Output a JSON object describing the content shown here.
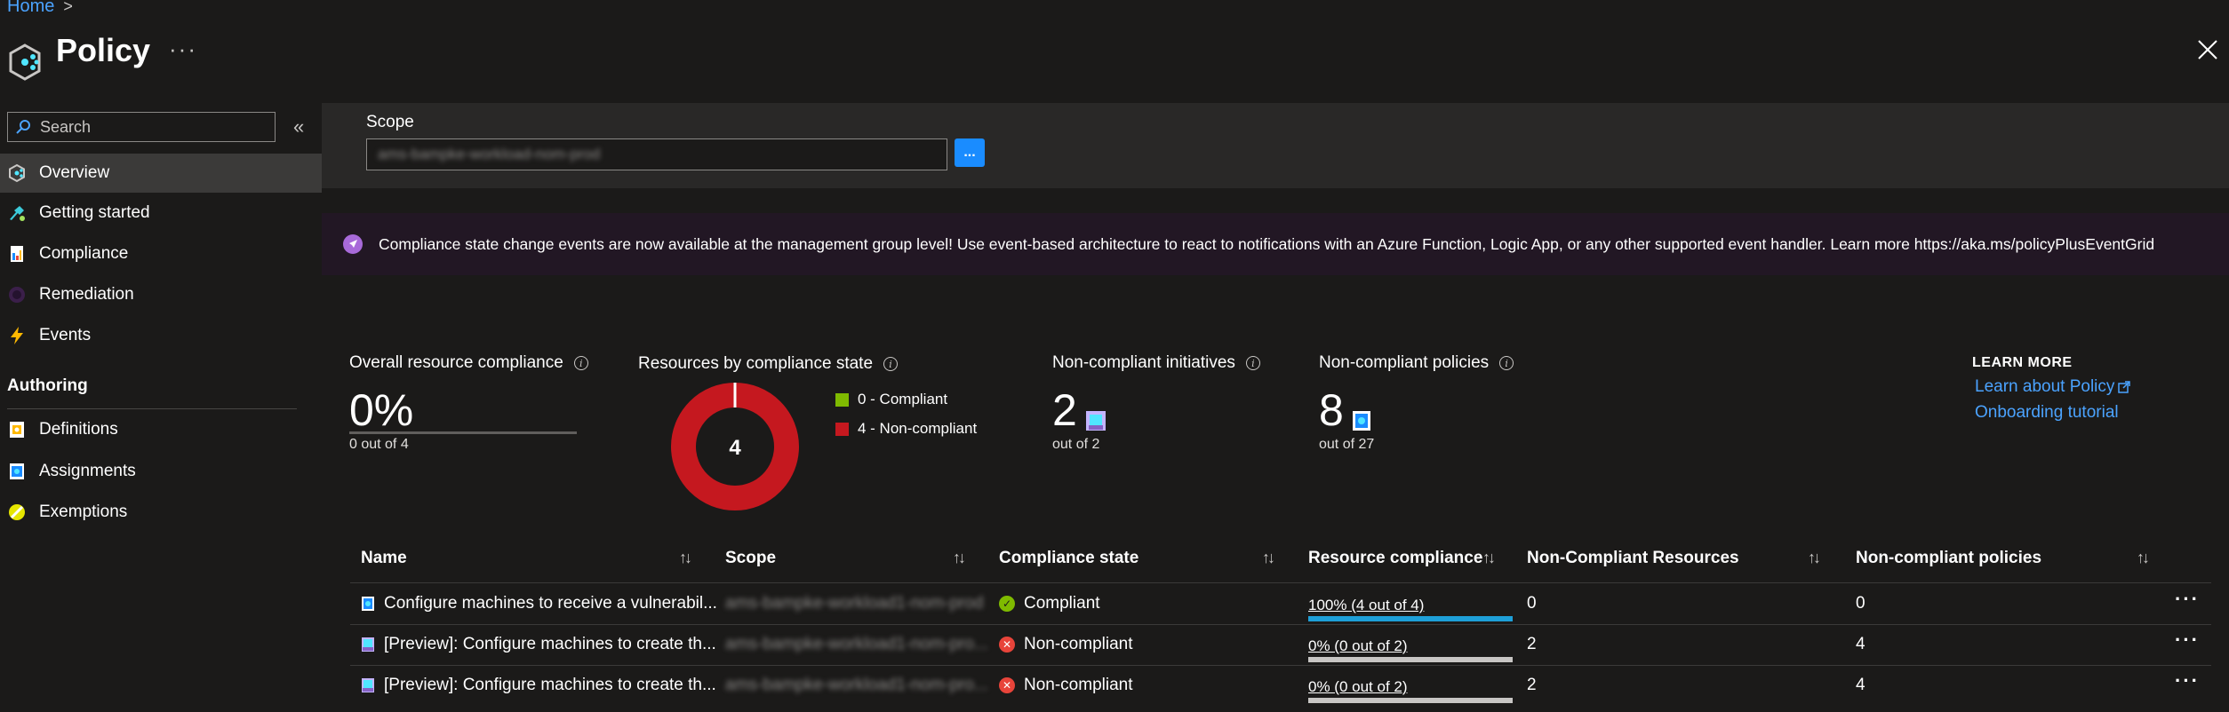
{
  "breadcrumb": {
    "home": "Home",
    "separator": ">"
  },
  "header": {
    "title": "Policy",
    "more": "···",
    "close_icon": "close-icon"
  },
  "search": {
    "placeholder": "Search"
  },
  "sidebar": {
    "collapse": "«",
    "items": [
      {
        "label": "Overview",
        "icon": "overview-icon",
        "active": true
      },
      {
        "label": "Getting started",
        "icon": "getting-started-icon"
      },
      {
        "label": "Compliance",
        "icon": "compliance-icon"
      },
      {
        "label": "Remediation",
        "icon": "remediation-icon"
      },
      {
        "label": "Events",
        "icon": "lightning-icon"
      }
    ],
    "authoring_title": "Authoring",
    "authoring_items": [
      {
        "label": "Definitions",
        "icon": "definitions-icon"
      },
      {
        "label": "Assignments",
        "icon": "assignments-icon"
      },
      {
        "label": "Exemptions",
        "icon": "exemptions-icon"
      }
    ]
  },
  "scope": {
    "label": "Scope",
    "value": "ams-bampke-workload-nom-prod",
    "button": "..."
  },
  "banner": {
    "text": "Compliance state change events are now available at the management group level! Use event-based architecture to react to notifications with an Azure Function, Logic App, or any other supported event handler. Learn more https://aka.ms/policyPlusEventGrid"
  },
  "stats": {
    "overall": {
      "title": "Overall resource compliance",
      "value": "0%",
      "sub": "0 out of 4",
      "fraction": 0
    },
    "by_state": {
      "title": "Resources by compliance state",
      "center": "4",
      "legend": [
        {
          "label": "0 - Compliant",
          "count": 0,
          "color": "#7fba00"
        },
        {
          "label": "4 - Non-compliant",
          "count": 4,
          "color": "#c5181f"
        }
      ]
    },
    "initiatives": {
      "title": "Non-compliant initiatives",
      "value": "2",
      "sub": "out of 2"
    },
    "policies": {
      "title": "Non-compliant policies",
      "value": "8",
      "sub": "out of 27"
    }
  },
  "learn_more": {
    "title": "LEARN MORE",
    "links": [
      "Learn about Policy",
      "Onboarding tutorial"
    ]
  },
  "table": {
    "headers": [
      "Name",
      "Scope",
      "Compliance state",
      "Resource compliance",
      "Non-Compliant Resources",
      "Non-compliant policies"
    ],
    "sort_icon": "↑↓",
    "rows": [
      {
        "name": "Configure machines to receive a vulnerabil...",
        "scope": "ams-bampke-workload1-nom-prod",
        "state": "Compliant",
        "compliance": "100% (4 out of 4)",
        "compliance_fraction": 1,
        "noncompliant_resources": "0",
        "noncompliant_policies": "0",
        "icon": "policy-icon"
      },
      {
        "name": "[Preview]: Configure machines to create th...",
        "scope": "ams-bampke-workload1-nom-pro...",
        "state": "Non-compliant",
        "compliance": "0% (0 out of 2)",
        "compliance_fraction": 0,
        "noncompliant_resources": "2",
        "noncompliant_policies": "4",
        "icon": "initiative-icon"
      },
      {
        "name": "[Preview]: Configure machines to create th...",
        "scope": "ams-bampke-workload1-nom-pro...",
        "state": "Non-compliant",
        "compliance": "0% (0 out of 2)",
        "compliance_fraction": 0,
        "noncompliant_resources": "2",
        "noncompliant_policies": "4",
        "icon": "initiative-icon"
      }
    ],
    "row_more": "···"
  },
  "colors": {
    "accent": "#1a8cff",
    "link": "#4ba3ff",
    "compliant": "#7fba00",
    "noncompliant": "#c5181f",
    "progress": "#1e9fd8"
  }
}
